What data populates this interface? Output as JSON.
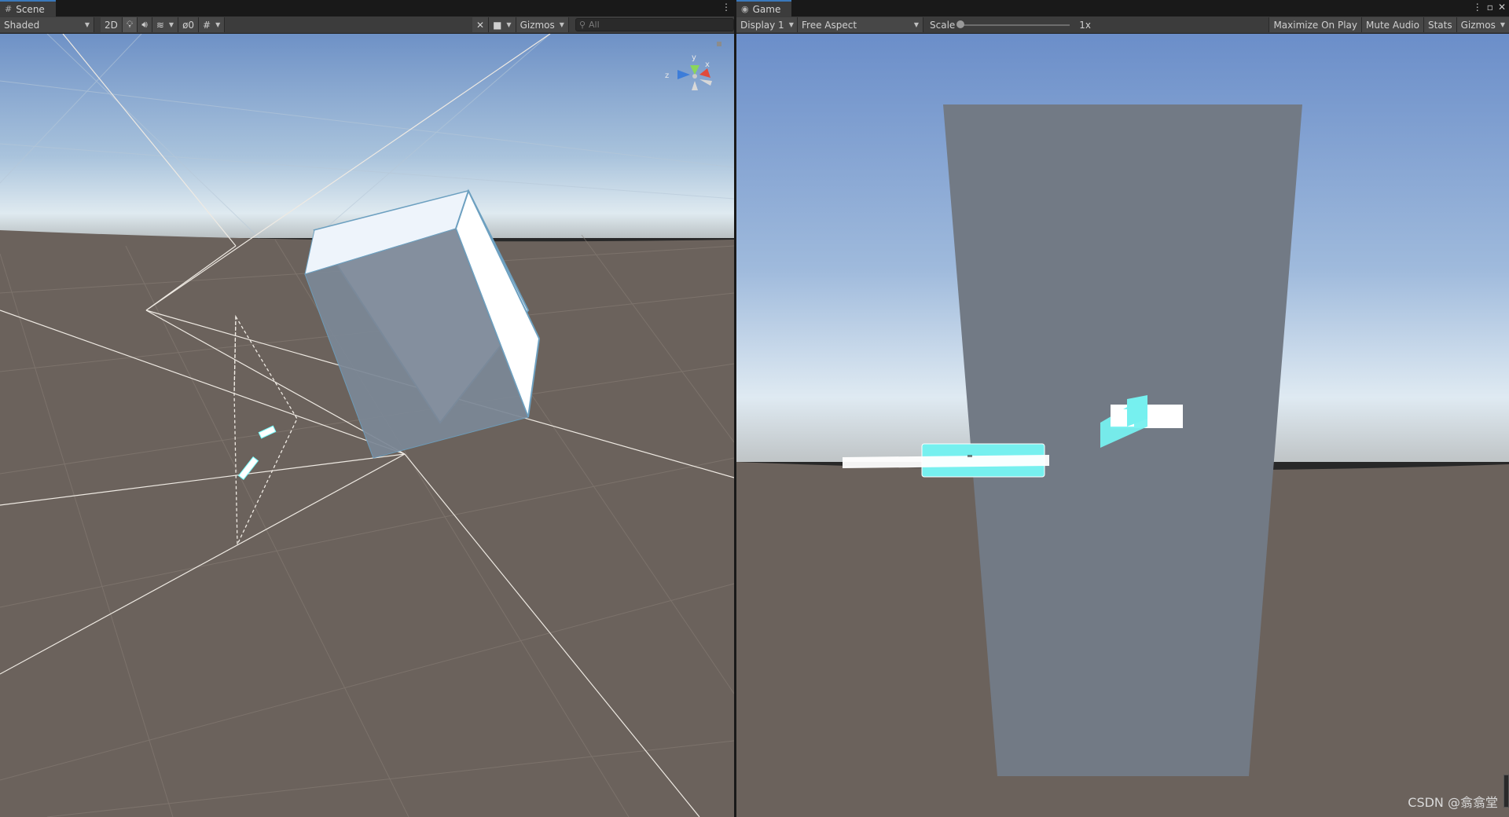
{
  "scene": {
    "tab_label": "Scene",
    "shading_mode": "Shaded",
    "btn_2d": "2D",
    "hidden_count": "0",
    "gizmos_label": "Gizmos",
    "search_placeholder": "All",
    "axis_labels": {
      "y": "y",
      "z": "z",
      "x": "x"
    }
  },
  "game": {
    "tab_label": "Game",
    "display": "Display 1",
    "aspect": "Free Aspect",
    "scale_label": "Scale",
    "scale_value": "1x",
    "scale_fraction": 0.0,
    "maximize_on_play": "Maximize On Play",
    "mute_audio": "Mute Audio",
    "stats": "Stats",
    "gizmos_label": "Gizmos"
  },
  "watermark": "CSDN @翕翕堂",
  "colors": {
    "toolbar_bg": "#3c3c3c",
    "tab_accent": "#3a79bb",
    "sky_top": "#6f95cc",
    "horizon": "#cfe0ea",
    "ground": "#6b625c",
    "canvas": "#727a85",
    "ui_cyan": "#76f0ef"
  },
  "icons": [
    "grid-icon",
    "light-icon",
    "audio-icon",
    "effects-icon",
    "visibility-icon",
    "grid-snap-icon",
    "tools-icon",
    "camera-icon",
    "search-icon",
    "gamepad-icon",
    "kebab-icon",
    "maximize-icon",
    "close-icon",
    "lock-icon"
  ]
}
